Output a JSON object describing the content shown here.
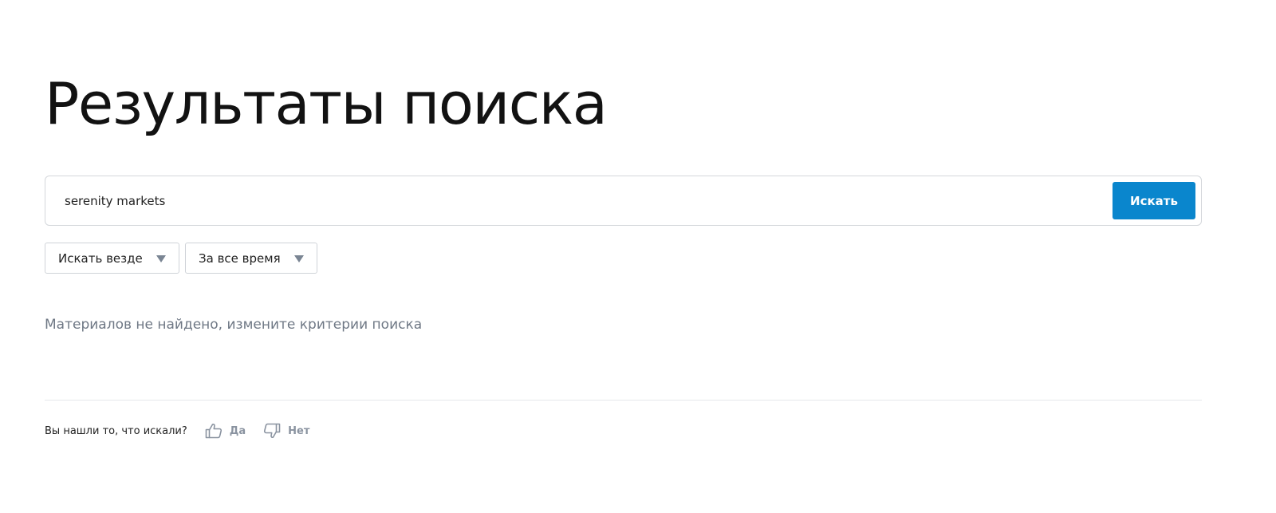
{
  "page": {
    "title": "Результаты поиска"
  },
  "search": {
    "query": "serenity markets",
    "button_label": "Искать"
  },
  "filters": {
    "scope": "Искать везде",
    "period": "За все время"
  },
  "results": {
    "empty_message": "Материалов не найдено, измените критерии поиска"
  },
  "feedback": {
    "question": "Вы нашли то, что искали?",
    "yes_label": "Да",
    "no_label": "Нет"
  },
  "colors": {
    "accent": "#0a86cd",
    "muted_text": "#6f7885",
    "icon_gray": "#8a93a0"
  },
  "icons": {
    "filter_caret": "caret-down-icon",
    "yes": "thumbs-up-icon",
    "no": "thumbs-down-icon"
  }
}
